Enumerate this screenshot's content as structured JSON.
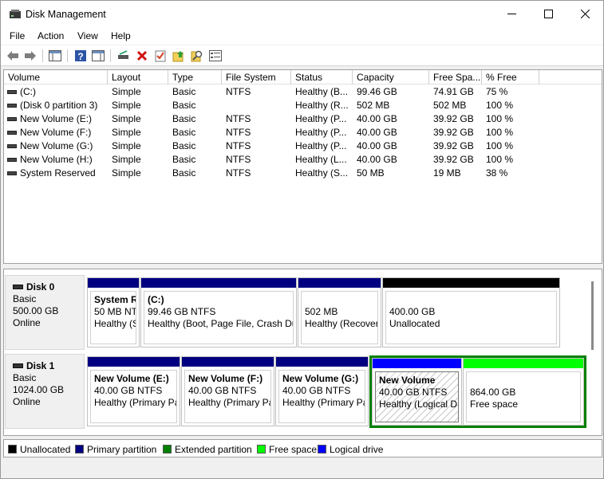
{
  "window": {
    "title": "Disk Management"
  },
  "menu": [
    "File",
    "Action",
    "View",
    "Help"
  ],
  "toolbar_icons": [
    "back-arrow-icon",
    "forward-arrow-icon",
    "properties-pane-icon",
    "help-icon",
    "show-hide-pane-icon",
    "connect-disk-icon",
    "delete-icon",
    "check-icon",
    "refresh-folder-icon",
    "search-icon",
    "settings-icon"
  ],
  "columns": [
    "Volume",
    "Layout",
    "Type",
    "File System",
    "Status",
    "Capacity",
    "Free Spa...",
    "% Free"
  ],
  "volumes": [
    [
      "(C:)",
      "Simple",
      "Basic",
      "NTFS",
      "Healthy (B...",
      "99.46 GB",
      "74.91 GB",
      "75 %"
    ],
    [
      "(Disk 0 partition 3)",
      "Simple",
      "Basic",
      "",
      "Healthy (R...",
      "502 MB",
      "502 MB",
      "100 %"
    ],
    [
      "New Volume (E:)",
      "Simple",
      "Basic",
      "NTFS",
      "Healthy (P...",
      "40.00 GB",
      "39.92 GB",
      "100 %"
    ],
    [
      "New Volume (F:)",
      "Simple",
      "Basic",
      "NTFS",
      "Healthy (P...",
      "40.00 GB",
      "39.92 GB",
      "100 %"
    ],
    [
      "New Volume (G:)",
      "Simple",
      "Basic",
      "NTFS",
      "Healthy (P...",
      "40.00 GB",
      "39.92 GB",
      "100 %"
    ],
    [
      "New Volume (H:)",
      "Simple",
      "Basic",
      "NTFS",
      "Healthy (L...",
      "40.00 GB",
      "39.92 GB",
      "100 %"
    ],
    [
      "System Reserved",
      "Simple",
      "Basic",
      "NTFS",
      "Healthy (S...",
      "50 MB",
      "19 MB",
      "38 %"
    ]
  ],
  "disks": [
    {
      "name": "Disk 0",
      "type": "Basic",
      "size": "500.00 GB",
      "state": "Online",
      "partitions": [
        {
          "name": "System R",
          "line2": "50 MB NTF",
          "line3": "Healthy (S",
          "kind": "primary"
        },
        {
          "name": "(C:)",
          "line2": "99.46 GB NTFS",
          "line3": "Healthy (Boot, Page File, Crash Du",
          "kind": "primary"
        },
        {
          "name": "",
          "line2": "502 MB",
          "line3": "Healthy (Recover",
          "kind": "primary"
        },
        {
          "name": "",
          "line2": "400.00 GB",
          "line3": "Unallocated",
          "kind": "unallocated"
        }
      ]
    },
    {
      "name": "Disk 1",
      "type": "Basic",
      "size": "1024.00 GB",
      "state": "Online",
      "partitions": [
        {
          "name": "New Volume  (E:)",
          "line2": "40.00 GB NTFS",
          "line3": "Healthy (Primary Pa",
          "kind": "primary"
        },
        {
          "name": "New Volume  (F:)",
          "line2": "40.00 GB NTFS",
          "line3": "Healthy (Primary Pa",
          "kind": "primary"
        },
        {
          "name": "New Volume  (G:)",
          "line2": "40.00 GB NTFS",
          "line3": "Healthy (Primary Pa",
          "kind": "primary"
        },
        {
          "name": "New Volume",
          "line2": "40.00 GB NTFS",
          "line3": "Healthy (Logical D",
          "kind": "logical"
        },
        {
          "name": "",
          "line2": "864.00 GB",
          "line3": "Free space",
          "kind": "free"
        }
      ]
    }
  ],
  "legend": [
    {
      "label": "Unallocated",
      "color": "#000000"
    },
    {
      "label": "Primary partition",
      "color": "#000080"
    },
    {
      "label": "Extended partition",
      "color": "#008000"
    },
    {
      "label": "Free space",
      "color": "#00ff00"
    },
    {
      "label": "Logical drive",
      "color": "#0000ff"
    }
  ],
  "colors": {
    "primary": "#000080",
    "unallocated": "#000000",
    "extended": "#008000",
    "free": "#00ff00",
    "logical": "#0000ff"
  }
}
